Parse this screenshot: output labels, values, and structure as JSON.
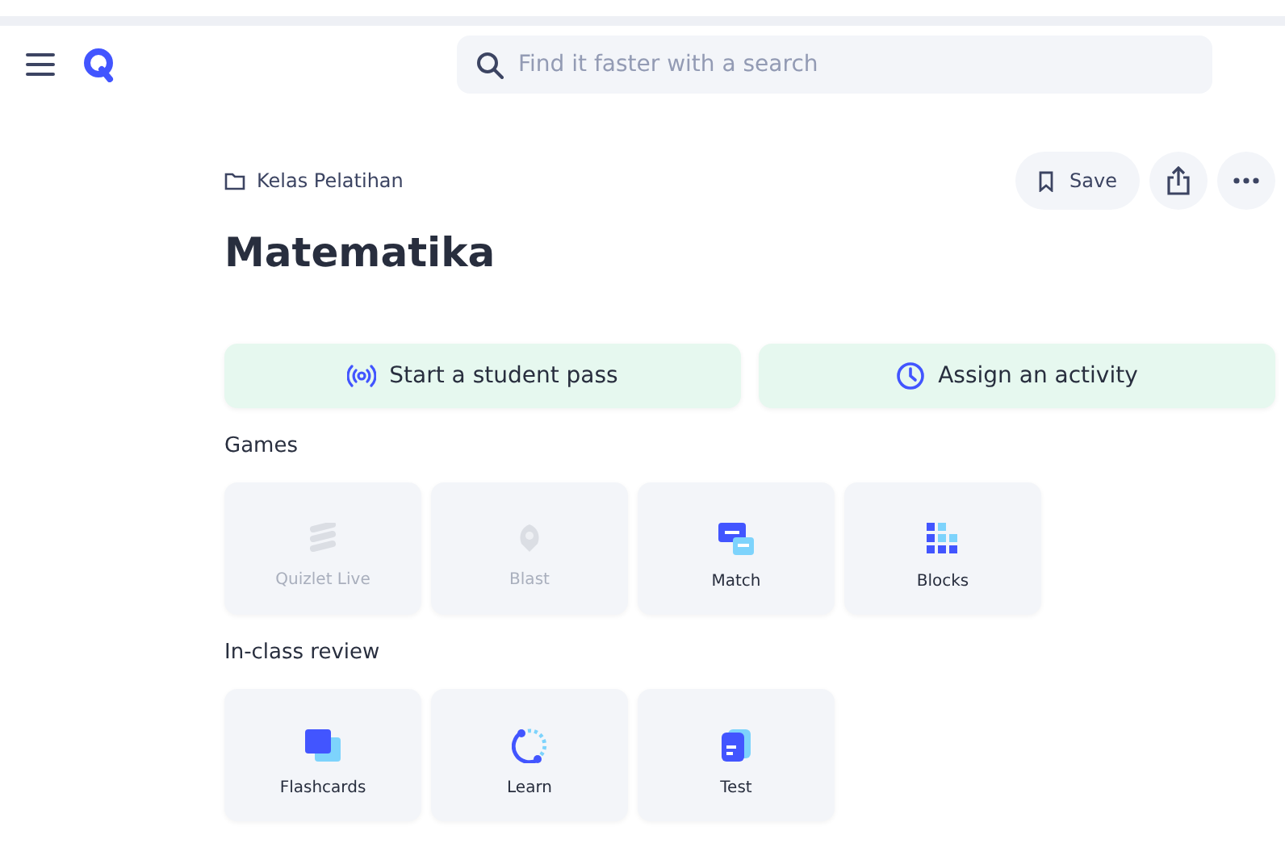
{
  "header": {
    "search": {
      "placeholder": "Find it faster with a search"
    }
  },
  "breadcrumb": "Kelas Pelatihan",
  "toolbar": {
    "save": "Save"
  },
  "title": "Matematika",
  "actions": [
    {
      "kind": "pass",
      "label": "Start a student pass"
    },
    {
      "kind": "assign",
      "label": "Assign an activity"
    }
  ],
  "sections": [
    {
      "heading": "Games",
      "tiles": [
        {
          "kind": "live",
          "label": "Quizlet Live",
          "disabled": true
        },
        {
          "kind": "blast",
          "label": "Blast",
          "disabled": true
        },
        {
          "kind": "match",
          "label": "Match",
          "disabled": false
        },
        {
          "kind": "blocks",
          "label": "Blocks",
          "disabled": false
        }
      ]
    },
    {
      "heading": "In-class review",
      "tiles": [
        {
          "kind": "flashcards",
          "label": "Flashcards",
          "disabled": false
        },
        {
          "kind": "learn",
          "label": "Learn",
          "disabled": false
        },
        {
          "kind": "test",
          "label": "Test",
          "disabled": false
        }
      ]
    }
  ]
}
